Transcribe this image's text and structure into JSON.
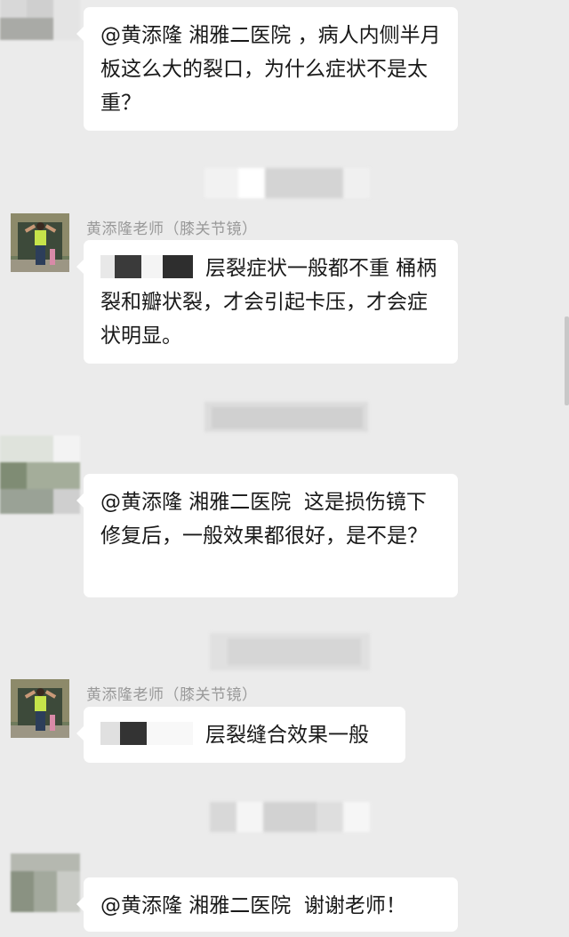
{
  "colors": {
    "background": "#ebebeb",
    "bubble": "#ffffff",
    "sender_name": "#999999",
    "message_text": "#191919"
  },
  "messages": [
    {
      "sender": "",
      "avatar": "blurred-avatar",
      "text": "@黄添隆 湘雅二医院 ，病人内侧半月板这么大的裂口，为什么症状不是太重？"
    },
    {
      "sender": "黄添隆老师（膝关节镜）",
      "avatar": "photo-avatar",
      "text": "层裂症状一般都不重 桶柄裂和瓣状裂，才会引起卡压，才会症状明显。",
      "redacted_prefix": true
    },
    {
      "sender": "",
      "avatar": "blurred-avatar",
      "text": "@黄添隆 湘雅二医院  这是损伤镜下修复后，一般效果都很好，是不是？"
    },
    {
      "sender": "黄添隆老师（膝关节镜）",
      "avatar": "photo-avatar",
      "text": "层裂缝合效果一般",
      "redacted_prefix": true
    },
    {
      "sender": "",
      "avatar": "blurred-avatar",
      "text": "@黄添隆 湘雅二医院  谢谢老师！"
    }
  ]
}
